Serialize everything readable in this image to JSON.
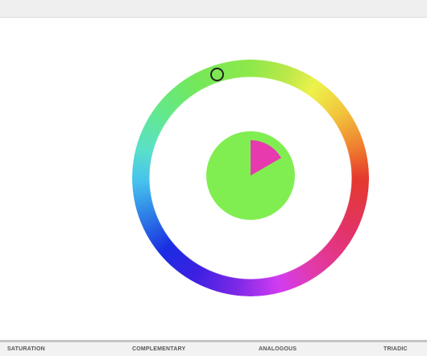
{
  "palette": {
    "base_color": "#80ee50",
    "accent_color": "#e63aae"
  },
  "wheel": {
    "handle_icon": "circle-handle-icon"
  },
  "tabs": [
    {
      "label": "SATURATION"
    },
    {
      "label": "COMPLEMENTARY"
    },
    {
      "label": "ANALOGOUS"
    },
    {
      "label": "TRIADIC"
    }
  ]
}
